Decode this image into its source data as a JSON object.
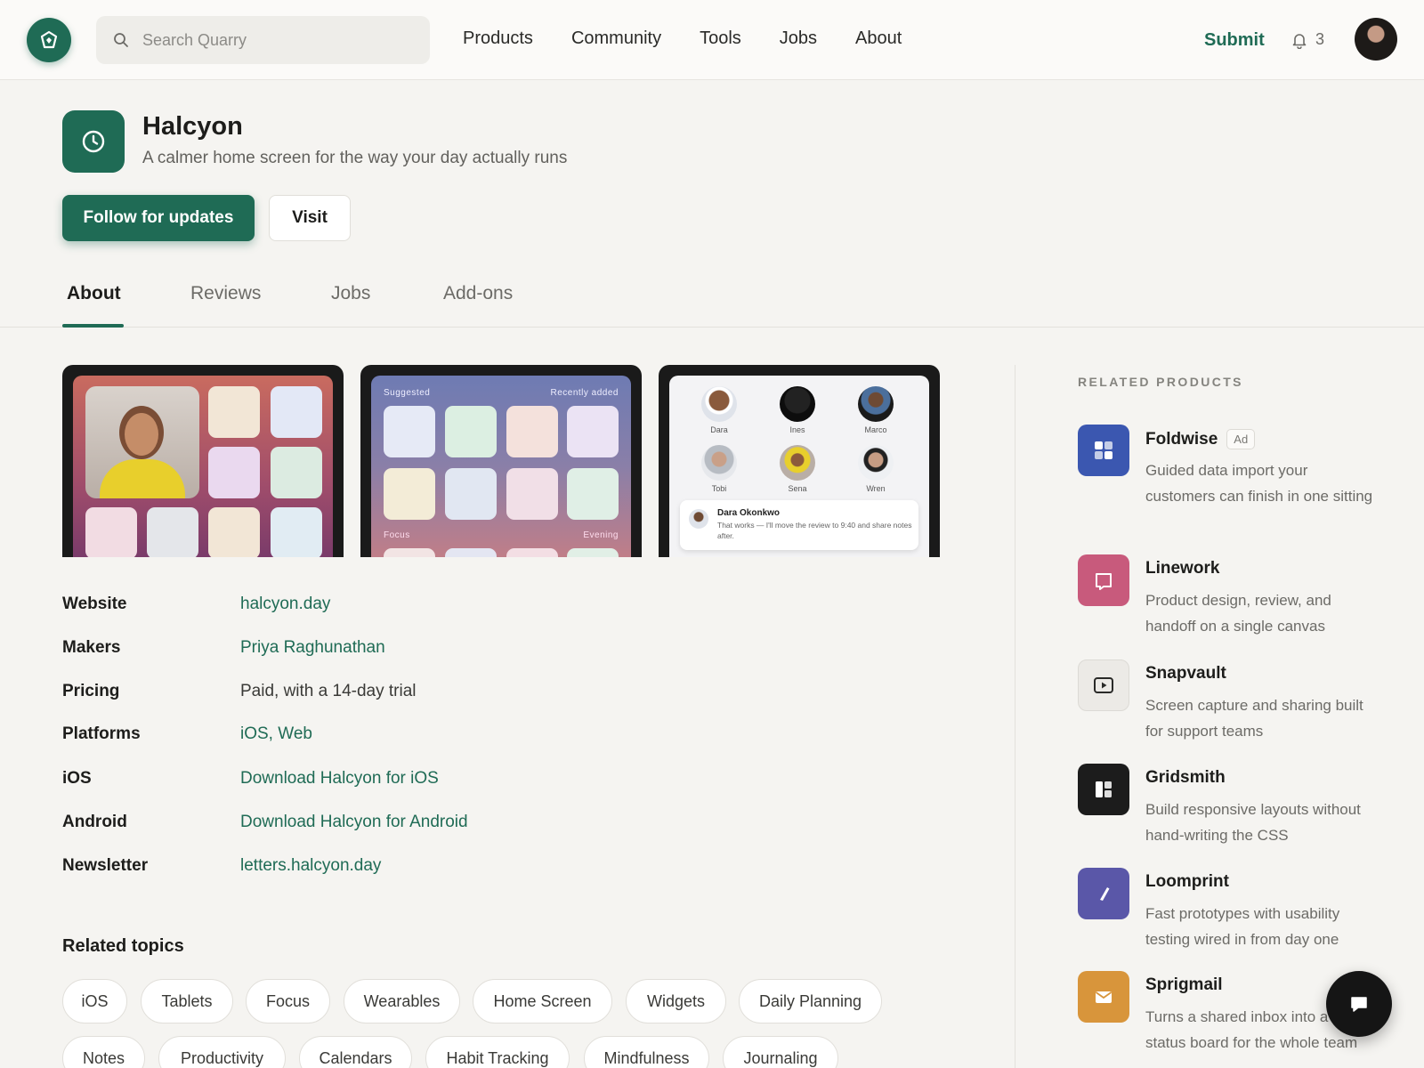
{
  "header": {
    "search_placeholder": "Search Quarry",
    "nav": [
      "Products",
      "Community",
      "Tools",
      "Jobs",
      "About"
    ],
    "submit_label": "Submit",
    "notification_count": "3"
  },
  "product": {
    "name": "Halcyon",
    "tagline": "A calmer home screen for the way your day actually runs",
    "follow_label": "Follow for updates",
    "visit_label": "Visit"
  },
  "tabs": [
    "About",
    "Reviews",
    "Jobs",
    "Add-ons"
  ],
  "active_tab": "About",
  "screenshots": {
    "s2_labels": {
      "top_left": "Suggested",
      "top_right": "Recently added",
      "bottom_left": "Focus",
      "bottom_right": "Evening"
    },
    "s3_people": [
      "Dara",
      "Ines",
      "Marco",
      "Tobi",
      "Sena",
      "Wren"
    ],
    "s3_message": {
      "sender": "Dara Okonkwo",
      "text": "That works — I'll move the review to 9:40 and share notes after."
    }
  },
  "details": [
    {
      "label": "Website",
      "value": "halcyon.day",
      "link": true
    },
    {
      "label": "Makers",
      "value": "Priya Raghunathan",
      "link": true
    },
    {
      "label": "Pricing",
      "value": "Paid, with a 14-day trial",
      "link": false
    },
    {
      "label": "Platforms",
      "value": "iOS, Web",
      "link": true
    },
    {
      "label": "iOS",
      "value": "Download Halcyon for iOS",
      "link": true
    },
    {
      "label": "Android",
      "value": "Download Halcyon for Android",
      "link": true
    },
    {
      "label": "Newsletter",
      "value": "letters.halcyon.day",
      "link": true
    }
  ],
  "topics_title": "Related topics",
  "topics": [
    "iOS",
    "Tablets",
    "Focus",
    "Wearables",
    "Home Screen",
    "Widgets",
    "Daily Planning",
    "Notes",
    "Productivity",
    "Calendars",
    "Habit Tracking",
    "Mindfulness",
    "Journaling"
  ],
  "related": {
    "title": "RELATED PRODUCTS",
    "items": [
      {
        "name": "Foldwise",
        "badge": "Ad",
        "desc": "Guided data import your customers can finish in one sitting",
        "color": "#3b57b0",
        "icon": "grid-icon"
      },
      {
        "name": "Linework",
        "badge": "",
        "desc": "Product design, review, and handoff on a single canvas",
        "color": "#c85a7c",
        "icon": "book-icon"
      },
      {
        "name": "Snapvault",
        "badge": "",
        "desc": "Screen capture and sharing built for support teams",
        "color": "#eceae6",
        "icon": "play-icon"
      },
      {
        "name": "Gridsmith",
        "badge": "",
        "desc": "Build responsive layouts without hand-writing the CSS",
        "color": "#1c1c1c",
        "icon": "layout-icon"
      },
      {
        "name": "Loomprint",
        "badge": "",
        "desc": "Fast prototypes with usability testing wired in from day one",
        "color": "#5a57a8",
        "icon": "pen-icon"
      },
      {
        "name": "Sprigmail",
        "badge": "",
        "desc": "Turns a shared inbox into a live status board for the whole team",
        "color": "#d8953b",
        "icon": "mail-icon"
      }
    ]
  }
}
